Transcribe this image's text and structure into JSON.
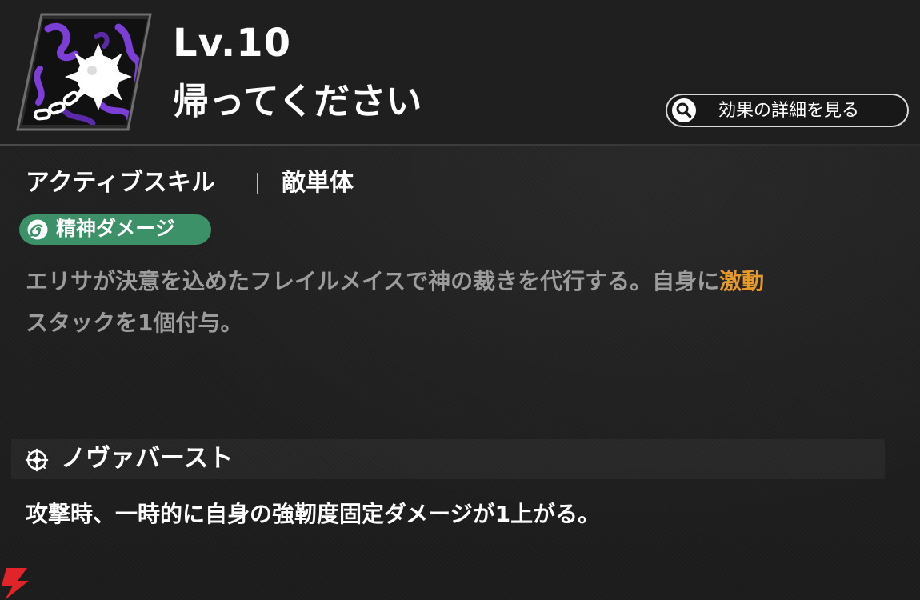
{
  "skill": {
    "level": "Lv.10",
    "name": "帰ってください",
    "icon": "flail-mace-icon"
  },
  "detail_button": {
    "label": "効果の詳細を見る",
    "icon": "search-icon"
  },
  "skill_type": {
    "category": "アクティブスキル",
    "target": "敵単体"
  },
  "damage_badge": {
    "label": "精神ダメージ",
    "icon": "spiral-icon",
    "color": "#3c9168"
  },
  "description": {
    "text": "エリサが決意を込めたフレイルメイスで神の裁きを代行する。自身に",
    "keyword": "激動",
    "text_after": "スタックを1個付与。",
    "keyword_color": "#e69a2c"
  },
  "passive": {
    "title": "ノヴァバースト",
    "icon": "nova-burst-icon",
    "description": "攻撃時、一時的に自身の強靭度固定ダメージが1上がる。"
  },
  "colors": {
    "icon_accent": "#7b3fd6",
    "corner_mark": "#e0242a"
  }
}
